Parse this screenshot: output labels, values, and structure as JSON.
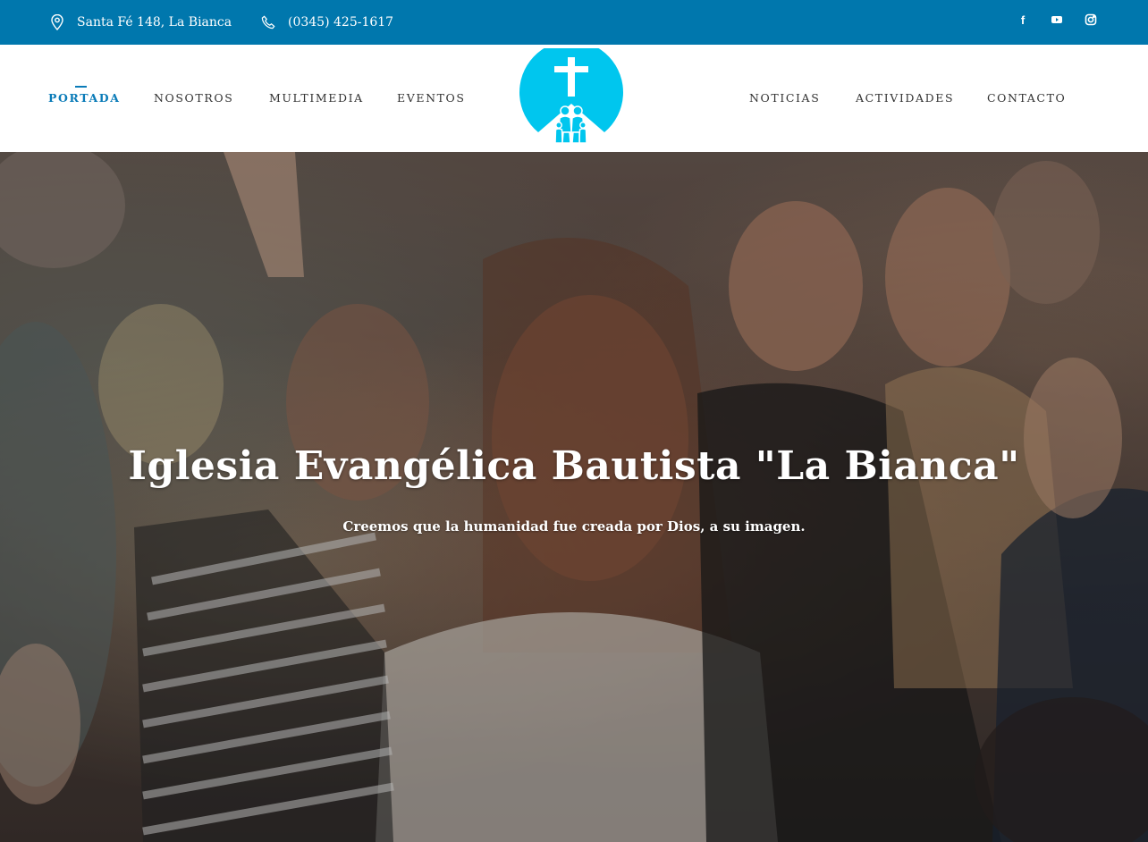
{
  "topbar": {
    "address": "Santa Fé 148, La Bianca",
    "phone": "(0345) 425-1617",
    "social": [
      {
        "icon": "facebook-icon",
        "glyph": "f"
      },
      {
        "icon": "youtube-icon",
        "glyph": "▶"
      },
      {
        "icon": "instagram-icon",
        "glyph": "◎"
      }
    ],
    "background": "#0077ad"
  },
  "nav": {
    "left_items": [
      "PORTADA",
      "NOSOTROS",
      "MULTIMEDIA",
      "EVENTOS"
    ],
    "right_items": [
      "NOTICIAS",
      "ACTIVIDADES",
      "CONTACTO"
    ],
    "active": "PORTADA",
    "accent": "#0a7bb8"
  },
  "logo": {
    "icon": "church-cross-family-logo",
    "color": "#00c6ee"
  },
  "hero": {
    "title": "Iglesia Evangélica Bautista \"La Bianca\"",
    "subtitle": "Creemos que la humanidad fue creada por Dios, a su imagen."
  }
}
